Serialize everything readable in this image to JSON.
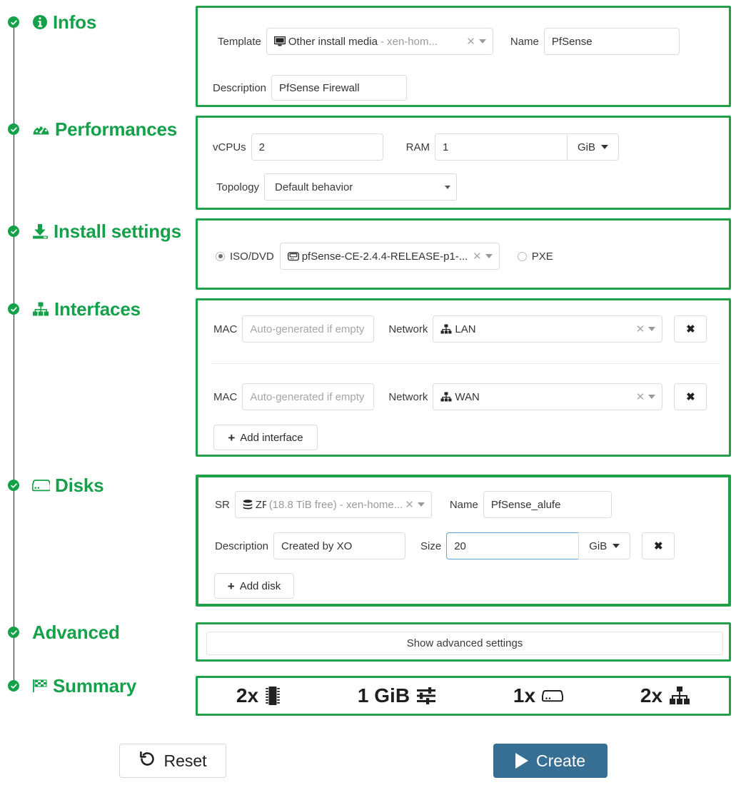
{
  "steps": [
    {
      "id": "infos",
      "label": "Infos",
      "icon": "info-circle-icon",
      "done": true
    },
    {
      "id": "perf",
      "label": "Performances",
      "icon": "tachometer-icon",
      "done": true
    },
    {
      "id": "install",
      "label": "Install settings",
      "icon": "download-icon",
      "done": true
    },
    {
      "id": "ifaces",
      "label": "Interfaces",
      "icon": "sitemap-icon",
      "done": true
    },
    {
      "id": "disks",
      "label": "Disks",
      "icon": "hdd-icon",
      "done": true
    },
    {
      "id": "advanced",
      "label": "Advanced",
      "icon": "none",
      "done": true
    },
    {
      "id": "summary",
      "label": "Summary",
      "icon": "flag-checkered-icon",
      "done": true
    }
  ],
  "infos": {
    "template_label": "Template",
    "template_value": "Other install media",
    "template_sub": "- xen-hom...",
    "template_icon": "desktop-icon",
    "name_label": "Name",
    "name_value": "PfSense",
    "description_label": "Description",
    "description_value": "PfSense Firewall"
  },
  "performances": {
    "vcpus_label": "vCPUs",
    "vcpus_value": "2",
    "ram_label": "RAM",
    "ram_value": "1",
    "ram_unit": "GiB",
    "topology_label": "Topology",
    "topology_value": "Default behavior"
  },
  "install": {
    "iso_radio_label": "ISO/DVD",
    "iso_selected": true,
    "iso_value": "pfSense-CE-2.4.4-RELEASE-p1-...",
    "iso_icon": "cd-icon",
    "pxe_radio_label": "PXE",
    "pxe_selected": false
  },
  "interfaces": {
    "rows": [
      {
        "mac_label": "MAC",
        "mac_value": "",
        "mac_placeholder": "Auto-generated if empty",
        "network_label": "Network",
        "network_value": "LAN",
        "network_icon": "sitemap-icon",
        "remove_label": "✖"
      },
      {
        "mac_label": "MAC",
        "mac_value": "",
        "mac_placeholder": "Auto-generated if empty",
        "network_label": "Network",
        "network_value": "WAN",
        "network_icon": "sitemap-icon",
        "remove_label": "✖"
      }
    ],
    "add_label": "Add interface",
    "add_icon": "plus-icon"
  },
  "disks": {
    "sr_label": "SR",
    "sr_value": "ZFS",
    "sr_sub": "(18.8 TiB free) - xen-home...",
    "sr_icon": "database-icon",
    "name_label": "Name",
    "name_value": "PfSense_alufe",
    "description_label": "Description",
    "description_value": "Created by XO",
    "size_label": "Size",
    "size_value": "20",
    "size_unit": "GiB",
    "remove_label": "✖",
    "add_label": "Add disk",
    "add_icon": "plus-icon"
  },
  "advanced": {
    "show_label": "Show advanced settings"
  },
  "summary": {
    "items": [
      {
        "value": "2x",
        "icon": "cpu-icon"
      },
      {
        "value": "1 GiB",
        "icon": "memory-sliders-icon"
      },
      {
        "value": "1x",
        "icon": "hdd-icon"
      },
      {
        "value": "2x",
        "icon": "sitemap-icon"
      }
    ]
  },
  "footer": {
    "reset_label": "Reset",
    "reset_icon": "undo-icon",
    "create_label": "Create",
    "create_icon": "play-icon"
  },
  "colors": {
    "green": "#21a04a",
    "green_text": "#15a14a",
    "create_blue": "#366f93",
    "focus_blue": "#5aa9e0"
  }
}
